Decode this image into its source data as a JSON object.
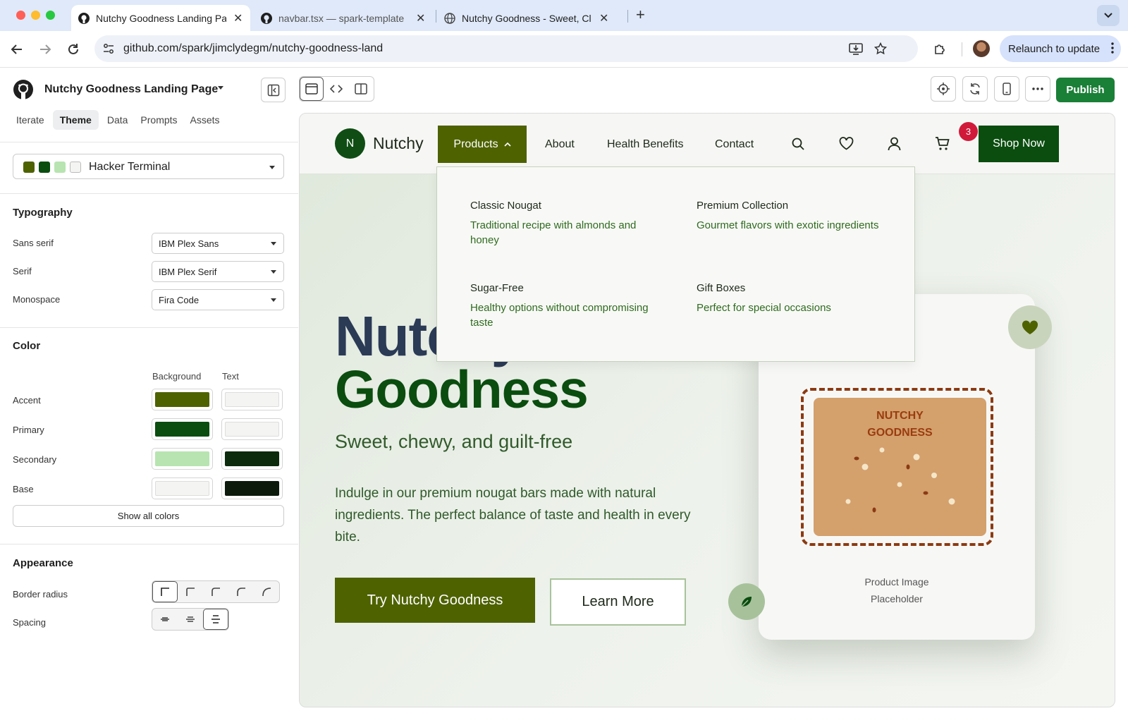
{
  "browser": {
    "tabs": [
      {
        "title": "Nutchy Goodness Landing Pa",
        "active": true
      },
      {
        "title": "navbar.tsx — spark-template",
        "active": false
      },
      {
        "title": "Nutchy Goodness - Sweet, Cl",
        "active": false
      }
    ],
    "url": "github.com/spark/jimclydegm/nutchy-goodness-land",
    "relaunch_label": "Relaunch to update"
  },
  "sidebar": {
    "project_title": "Nutchy Goodness Landing Page",
    "tabs": [
      "Iterate",
      "Theme",
      "Data",
      "Prompts",
      "Assets"
    ],
    "active_tab": "Theme",
    "theme": {
      "name": "Hacker Terminal",
      "swatches": [
        "#4e6200",
        "#0a4d0f",
        "#b7e4b0",
        "#f4f5f2"
      ]
    },
    "typography": {
      "heading": "Typography",
      "rows": [
        {
          "label": "Sans serif",
          "value": "IBM Plex Sans"
        },
        {
          "label": "Serif",
          "value": "IBM Plex Serif"
        },
        {
          "label": "Monospace",
          "value": "Fira Code"
        }
      ]
    },
    "color": {
      "heading": "Color",
      "col_background": "Background",
      "col_text": "Text",
      "rows": [
        {
          "label": "Accent",
          "bg": "#4e6200",
          "text": "#f4f5f2"
        },
        {
          "label": "Primary",
          "bg": "#0a4d0f",
          "text": "#f4f5f2"
        },
        {
          "label": "Secondary",
          "bg": "#b7e4b0",
          "text": "#0c2a0c"
        },
        {
          "label": "Base",
          "bg": "#f4f5f2",
          "text": "#0c1a0c"
        }
      ],
      "show_all": "Show all colors"
    },
    "appearance": {
      "heading": "Appearance",
      "border_radius_label": "Border radius",
      "spacing_label": "Spacing"
    }
  },
  "toolbar": {
    "publish_label": "Publish"
  },
  "site": {
    "logo_letter": "N",
    "brand": "Nutchy",
    "nav": {
      "products": "Products",
      "about": "About",
      "health": "Health Benefits",
      "contact": "Contact",
      "cart_count": "3",
      "shop_now": "Shop Now"
    },
    "dropdown": [
      {
        "title": "Classic Nougat",
        "desc": "Traditional recipe with almonds and honey"
      },
      {
        "title": "Premium Collection",
        "desc": "Gourmet flavors with exotic ingredients"
      },
      {
        "title": "Sugar-Free",
        "desc": "Healthy options without compromising taste"
      },
      {
        "title": "Gift Boxes",
        "desc": "Perfect for special occasions"
      }
    ],
    "hero": {
      "title_line1": "Nutchy",
      "title_line2": "Goodness",
      "tagline": "Sweet, chewy, and guilt-free",
      "description": "Indulge in our premium nougat bars made with natural ingredients. The perfect balance of taste and health in every bite.",
      "cta_primary": "Try Nutchy Goodness",
      "cta_secondary": "Learn More"
    },
    "product_card": {
      "label_line1": "NUTCHY",
      "label_line2": "GOODNESS",
      "caption_line1": "Product Image",
      "caption_line2": "Placeholder"
    }
  }
}
